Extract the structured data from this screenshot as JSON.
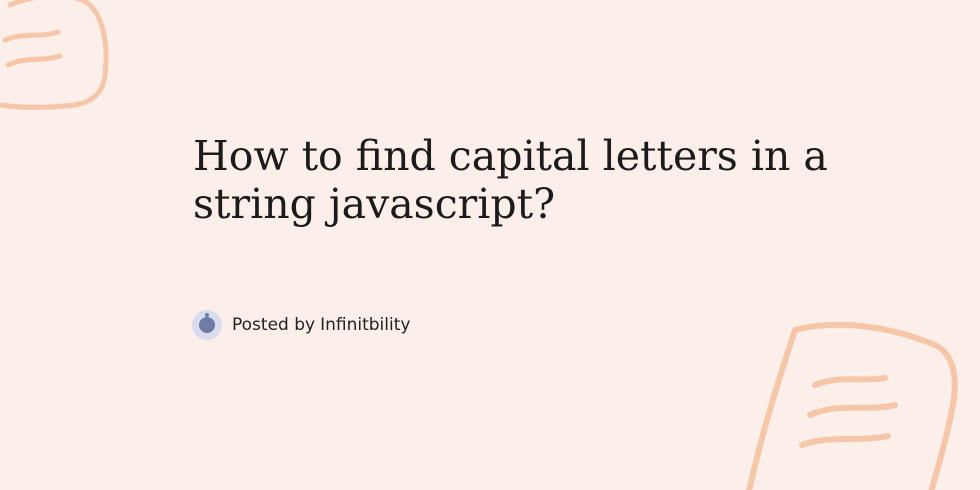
{
  "post": {
    "title": "How to find capital letters in a string javascript?",
    "byline_prefix": "Posted by",
    "author": "Infinitbility"
  },
  "colors": {
    "background": "#fcefea",
    "decoration": "#f6c6a8",
    "title_text": "#1b1b1b",
    "avatar_ring": "#d9dcef",
    "avatar_core": "#6f7aa6"
  },
  "icons": {
    "top_left": "doodle-scribble-icon",
    "bottom_right": "doodle-note-icon",
    "author_avatar": "author-avatar-icon"
  }
}
